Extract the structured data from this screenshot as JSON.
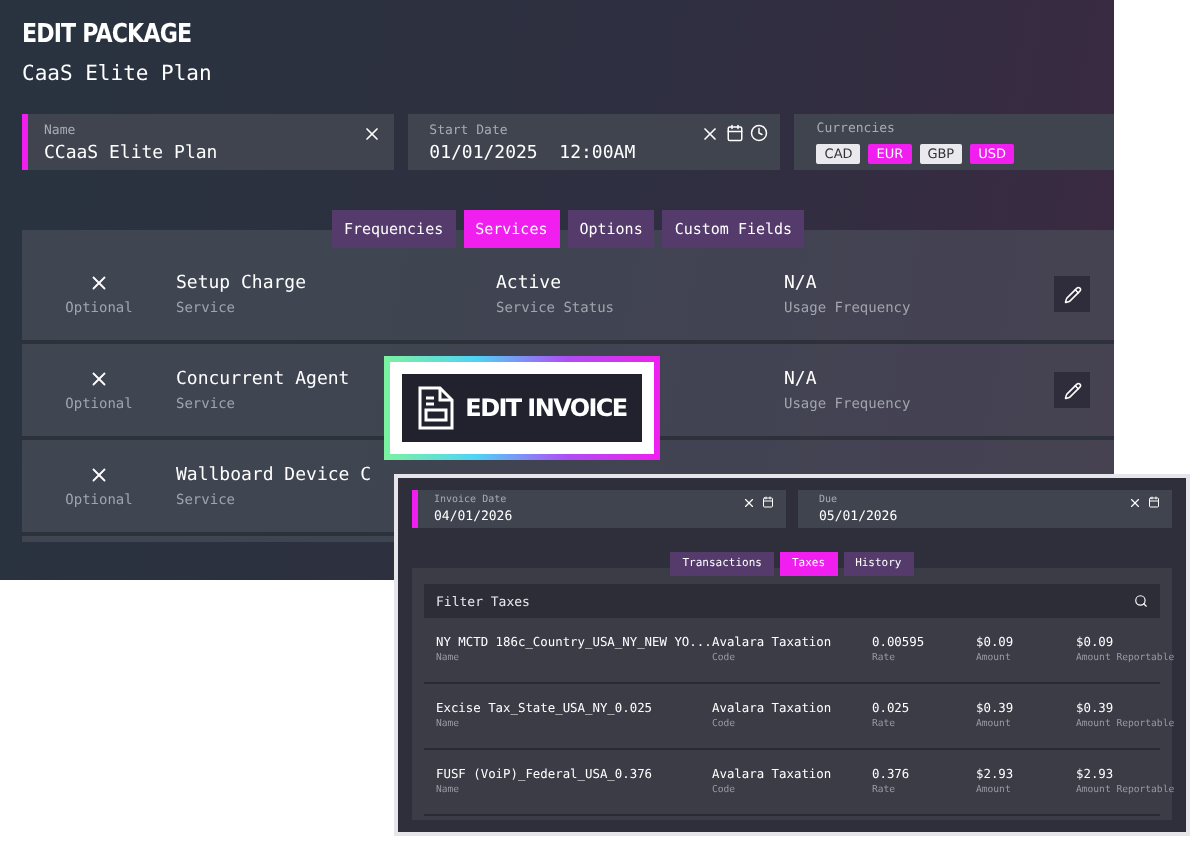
{
  "package": {
    "title": "EDIT PACKAGE",
    "subtitle": "CaaS Elite Plan",
    "fields": [
      {
        "kind": "text",
        "label": "Name",
        "value": "CCaaS Elite Plan",
        "focused": true
      },
      {
        "kind": "datetime",
        "label": "Start Date",
        "value": "01/01/2025  12:00AM",
        "focused": false
      }
    ],
    "currencies": {
      "label": "Currencies",
      "options": [
        {
          "code": "CAD",
          "selected": false
        },
        {
          "code": "EUR",
          "selected": true
        },
        {
          "code": "GBP",
          "selected": false
        },
        {
          "code": "USD",
          "selected": true
        }
      ]
    },
    "tabs": [
      {
        "label": "Frequencies",
        "selected": false
      },
      {
        "label": "Services",
        "selected": true
      },
      {
        "label": "Options",
        "selected": false
      },
      {
        "label": "Custom Fields",
        "selected": false
      }
    ],
    "services": [
      {
        "optional": "Optional",
        "name": "Setup Charge",
        "name_label": "Service",
        "status": "Active",
        "status_label": "Service Status",
        "frequency": "N/A",
        "frequency_label": "Usage Frequency"
      },
      {
        "optional": "Optional",
        "name": "Concurrent Agent",
        "name_label": "Service",
        "frequency": "N/A",
        "frequency_label": "Usage Frequency"
      },
      {
        "optional": "Optional",
        "name": "Wallboard Device C",
        "name_label": "Service"
      }
    ]
  },
  "badge": {
    "text": "EDIT INVOICE"
  },
  "invoice": {
    "fields": [
      {
        "label": "Invoice Date",
        "value": "04/01/2026",
        "focused": true
      },
      {
        "label": "Due",
        "value": "05/01/2026",
        "focused": false
      }
    ],
    "tabs": [
      {
        "label": "Transactions",
        "selected": false
      },
      {
        "label": "Taxes",
        "selected": true
      },
      {
        "label": "History",
        "selected": false
      }
    ],
    "filter": {
      "placeholder": "Filter Taxes"
    },
    "rows": [
      {
        "cells": [
          {
            "value": "NY MCTD 186c_Country_USA_NY_NEW YO...",
            "label": "Name"
          },
          {
            "value": "Avalara Taxation",
            "label": "Code"
          },
          {
            "value": "0.00595",
            "label": "Rate"
          },
          {
            "value": "$0.09",
            "label": "Amount"
          },
          {
            "value": "$0.09",
            "label": "Amount Reportable"
          }
        ]
      },
      {
        "cells": [
          {
            "value": "Excise Tax_State_USA_NY_0.025",
            "label": "Name"
          },
          {
            "value": "Avalara Taxation",
            "label": "Code"
          },
          {
            "value": "0.025",
            "label": "Rate"
          },
          {
            "value": "$0.39",
            "label": "Amount"
          },
          {
            "value": "$0.39",
            "label": "Amount Reportable"
          }
        ]
      },
      {
        "cells": [
          {
            "value": "FUSF (VoiP)_Federal_USA_0.376",
            "label": "Name"
          },
          {
            "value": "Avalara Taxation",
            "label": "Code"
          },
          {
            "value": "0.376",
            "label": "Rate"
          },
          {
            "value": "$2.93",
            "label": "Amount"
          },
          {
            "value": "$2.93",
            "label": "Amount Reportable"
          }
        ]
      }
    ]
  }
}
